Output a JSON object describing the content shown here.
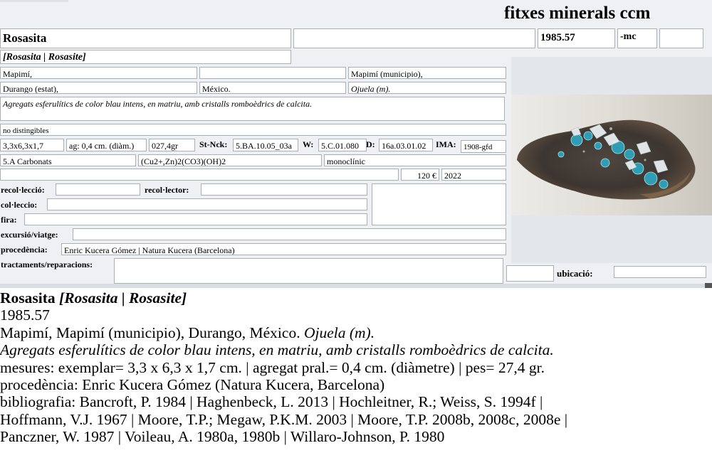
{
  "app": {
    "title": "fitxes minerals ccm"
  },
  "form": {
    "name": "Rosasita",
    "name_variants": "[Rosasita | Rosasite]",
    "catalog_number": "1985.57",
    "catalog_suffix": "-mc",
    "locality": "Mapimí,",
    "municipality": "Mapimí (municipio),",
    "state": "Durango (estat),",
    "country": "México.",
    "mine": "Ojuela (m).",
    "description": "Agregats esferulítics de color blau intens, en matriu, amb cristalls romboèdrics de calcita.",
    "distinguishable": "no distingibles",
    "dimensions": "3,3x6,3x1,7",
    "aggregate": "ag: 0,4 cm. (diàm.)",
    "weight": "027,4gr",
    "strunz_label": "St-Nck:",
    "strunz_value": "5.BA.10.05_03a",
    "w_label": "W:",
    "w_value": "5.C.01.080",
    "d_label": "D:",
    "d_value": "16a.03.01.02",
    "ima_label": "IMA:",
    "ima_value": "1908-gfd",
    "class": "5.A Carbonats",
    "formula": "(Cu2+,Zn)2(CO3)(OH)2",
    "crystal_system": "monoclínic",
    "price": "120 €",
    "year": "2022",
    "collection_label": "recol·lecció:",
    "collector_label": "recol·lector:",
    "colleccio_label": "col·leccio:",
    "fira_label": "fira:",
    "excursion_label": "excursió/viatge:",
    "provenance_label": "procedència:",
    "provenance_value": "Enric Kucera Gómez | Natura Kucera (Barcelona)",
    "treatments_label": "tractaments/reparacions:",
    "location_label": "ubicació:"
  },
  "photo": {
    "icon": "mineral-photo"
  },
  "summary": {
    "name": "Rosasita",
    "variants": "[Rosasita | Rosasite]",
    "catalog": "1985.57",
    "locality_plain": "Mapimí, Mapimí (municipio), Durango, México.",
    "locality_mine": "Ojuela (m).",
    "description": "Agregats esferulítics de color blau intens, en matriu, amb cristalls romboèdrics de calcita.",
    "measures": "mesures: exemplar= 3,3 x 6,3 x 1,7 cm. | agregat pral.= 0,4 cm. (diàmetre) | pes= 27,4 gr.",
    "provenance": "procedència: Enric Kucera Gómez (Natura Kucera, Barcelona)",
    "bibliography_1": "bibliografia: Bancroft, P. 1984 | Haghenbeck, L. 2013 | Hochleitner, R.; Weiss, S. 1994f |",
    "bibliography_2": "Hoffmann, V.J. 1967 | Moore, T.P.; Megaw, P.K.M. 2003 | Moore, T.P. 2008b, 2008c, 2008e |",
    "bibliography_3": "Panczner, W. 1987 | Voileau, A. 1980a, 1980b | Willaro-Johnson, P. 1980"
  }
}
